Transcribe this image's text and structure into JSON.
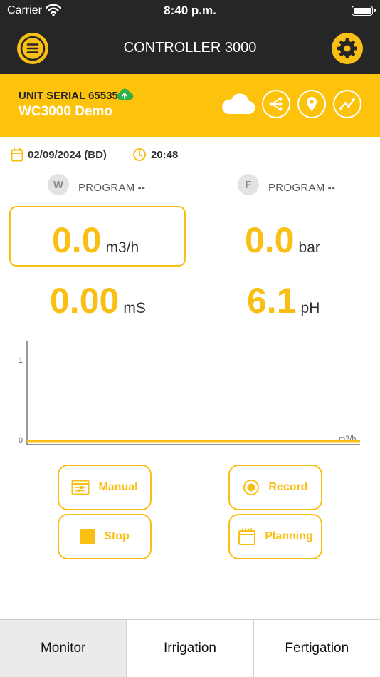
{
  "status_bar": {
    "carrier": "Carrier",
    "time": "8:40 p.m."
  },
  "header": {
    "title": "CONTROLLER 3000"
  },
  "unit": {
    "serial": "UNIT SERIAL 65535",
    "name": "WC3000 Demo"
  },
  "datetime": {
    "date": "02/09/2024 (BD)",
    "time": "20:48"
  },
  "programs": {
    "water": {
      "badge": "W",
      "label": "PROGRAM",
      "value": "--"
    },
    "fert": {
      "badge": "F",
      "label": "PROGRAM",
      "value": "--"
    }
  },
  "measurements": {
    "flow": {
      "value": "0.0",
      "unit": "m3/h"
    },
    "pressure": {
      "value": "0.0",
      "unit": "bar"
    },
    "ec": {
      "value": "0.00",
      "unit": "mS"
    },
    "ph": {
      "value": "6.1",
      "unit": "pH"
    }
  },
  "chart_data": {
    "type": "line",
    "y_ticks": [
      "1",
      "0"
    ],
    "ylim": [
      0,
      1
    ],
    "unit_label": "m3/h",
    "series": [
      {
        "values": [
          0,
          0
        ]
      }
    ],
    "color": "#f9bf14",
    "grid": false
  },
  "actions": {
    "manual": "Manual",
    "record": "Record",
    "stop": "Stop",
    "planning": "Planning"
  },
  "tabs": [
    {
      "label": "Monitor",
      "active": true
    },
    {
      "label": "Irrigation",
      "active": false
    },
    {
      "label": "Fertigation",
      "active": false
    }
  ],
  "colors": {
    "accent": "#f9bf14",
    "dark": "#262626",
    "upload": "#2fb04a"
  },
  "icons": {
    "menu": "menu-icon",
    "settings": "gear-icon",
    "upload": "cloud-upload-icon",
    "weather": "cloud-icon",
    "share": "share-icon",
    "location": "location-pin-icon",
    "trend": "trend-icon",
    "calendar": "calendar-icon",
    "clock": "clock-icon"
  }
}
